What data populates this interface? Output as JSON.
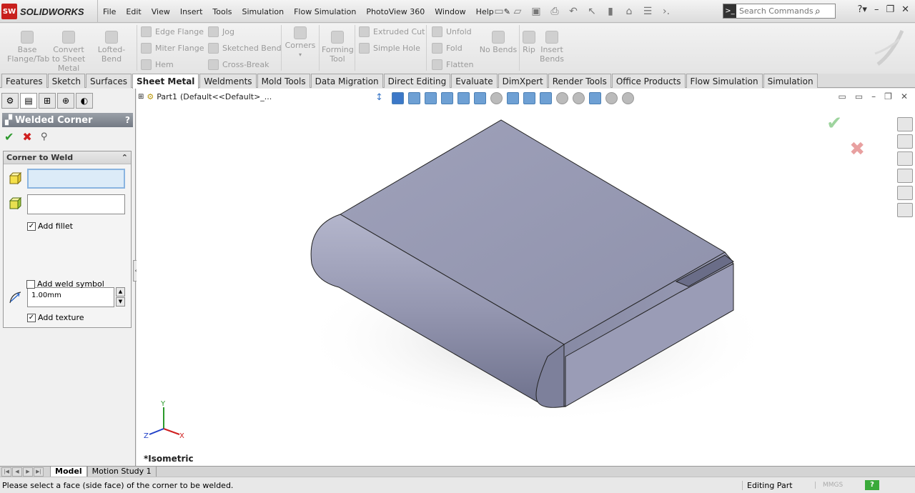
{
  "app": {
    "brand": "SOLIDWORKS",
    "logo_text": "SW"
  },
  "menu": [
    "File",
    "Edit",
    "View",
    "Insert",
    "Tools",
    "Simulation",
    "Flow Simulation",
    "PhotoView 360",
    "Window",
    "Help"
  ],
  "search": {
    "placeholder": "Search Commands"
  },
  "cmd": {
    "base_flange": "Base Flange/Tab",
    "convert": "Convert to Sheet Metal",
    "lofted": "Lofted-Bend",
    "edge_flange": "Edge Flange",
    "miter_flange": "Miter Flange",
    "hem": "Hem",
    "jog": "Jog",
    "sketched_bend": "Sketched Bend",
    "cross_break": "Cross-Break",
    "corners": "Corners",
    "forming_tool": "Forming Tool",
    "extruded_cut": "Extruded Cut",
    "simple_hole": "Simple Hole",
    "unfold": "Unfold",
    "fold": "Fold",
    "flatten": "Flatten",
    "no_bends": "No Bends",
    "rip": "Rip",
    "insert_bends": "Insert Bends"
  },
  "tabs": [
    "Features",
    "Sketch",
    "Surfaces",
    "Sheet Metal",
    "Weldments",
    "Mold Tools",
    "Data Migration",
    "Direct Editing",
    "Evaluate",
    "DimXpert",
    "Render Tools",
    "Office Products",
    "Flow Simulation",
    "Simulation"
  ],
  "active_tab": "Sheet Metal",
  "pm": {
    "title": "Welded Corner",
    "help": "?",
    "group_title": "Corner to Weld",
    "add_fillet": "Add fillet",
    "fillet_value": "1.00mm",
    "add_texture": "Add texture",
    "add_weld_symbol": "Add weld symbol",
    "add_fillet_checked": true,
    "add_texture_checked": true,
    "add_weld_symbol_checked": false
  },
  "tree": {
    "part": "Part1",
    "config": "(Default<<Default>_..."
  },
  "view": {
    "name": "*Isometric"
  },
  "triad": {
    "x": "X",
    "y": "Y",
    "z": "Z"
  },
  "bottom_tabs": [
    "Model",
    "Motion Study 1"
  ],
  "status": {
    "message": "Please select a face (side face) of the corner to be welded.",
    "mode": "Editing Part",
    "units": "MMGS",
    "help": "?"
  },
  "colors": {
    "part": "#9a9db4",
    "accent": "#3c78c8",
    "ok": "#2f9a2f",
    "cancel": "#d02020"
  }
}
